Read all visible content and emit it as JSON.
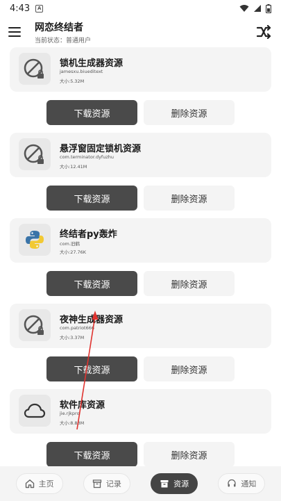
{
  "status_bar": {
    "time": "4:43",
    "notif_glyph": "A"
  },
  "app_bar": {
    "title": "网恋终结者",
    "subtitle": "当前状态：普通用户"
  },
  "items": [
    {
      "name": "锁机生成器资源",
      "package": "jamesxu.biueditext",
      "size": "大小:5.32M",
      "icon": "block-lock-icon"
    },
    {
      "name": "悬浮窗固定锁机资源",
      "package": "com.terminator.dyfuzhu",
      "size": "大小:12.41M",
      "icon": "block-lock-icon"
    },
    {
      "name": "终结者py轰炸",
      "package": "com.旧鹤",
      "size": "大小:27.76K",
      "icon": "python-icon"
    },
    {
      "name": "夜神生成器资源",
      "package": "com.patriot666",
      "size": "大小:3.37M",
      "icon": "block-lock-icon"
    },
    {
      "name": "软件库资源",
      "package": "jie.rjkpro",
      "size": "大小:8.83M",
      "icon": "cloud-icon"
    }
  ],
  "buttons": {
    "download": "下载资源",
    "delete": "删除资源"
  },
  "bottom_nav": [
    {
      "label": "主页",
      "icon": "home-icon",
      "active": false
    },
    {
      "label": "记录",
      "icon": "archive-icon",
      "active": false
    },
    {
      "label": "资源",
      "icon": "archive-filled-icon",
      "active": true
    },
    {
      "label": "通知",
      "icon": "headset-icon",
      "active": false
    }
  ],
  "colors": {
    "accent": "#4a4a4a",
    "card": "#f4f4f4",
    "annotation_arrow": "#e0332f"
  }
}
